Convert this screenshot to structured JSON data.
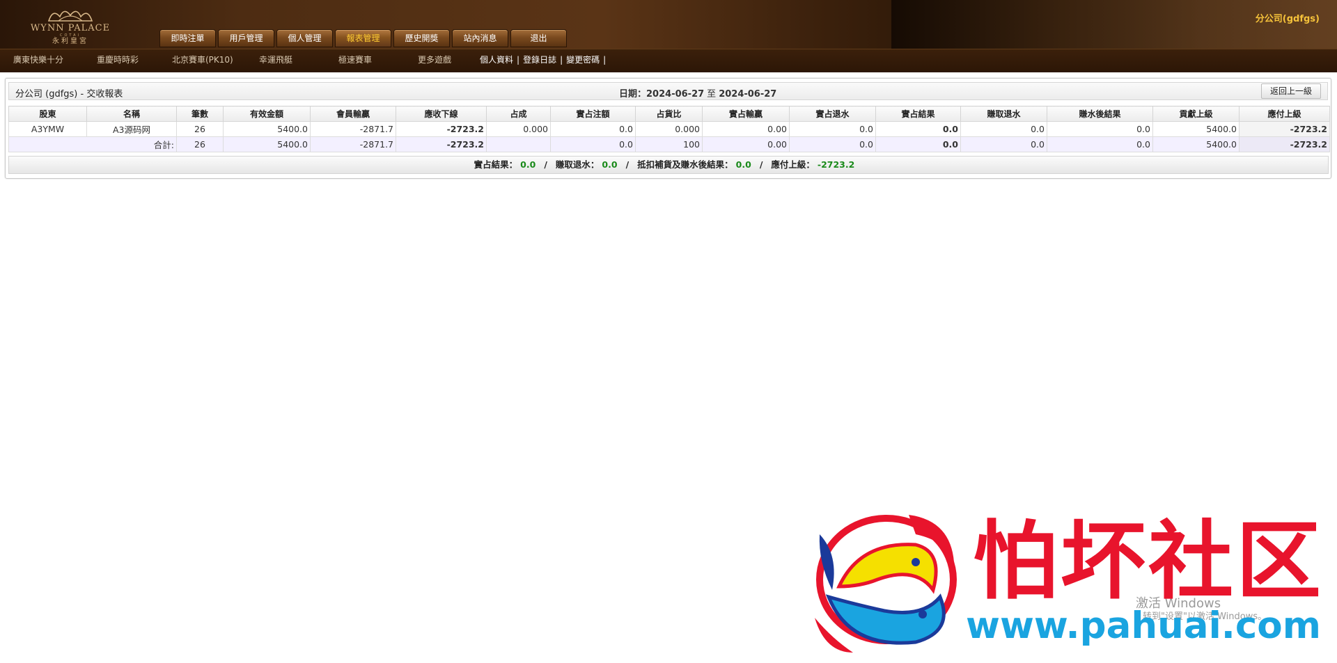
{
  "header": {
    "logo": {
      "en": "WYNN PALACE",
      "cotai": "COTAI",
      "cn": "永利皇宮"
    },
    "main_nav": [
      {
        "label": "即時注單",
        "active": false
      },
      {
        "label": "用戶管理",
        "active": false
      },
      {
        "label": "個人管理",
        "active": false
      },
      {
        "label": "報表管理",
        "active": true
      },
      {
        "label": "歷史開獎",
        "active": false
      },
      {
        "label": "站內消息",
        "active": false
      },
      {
        "label": "退出",
        "active": false
      }
    ],
    "company": "分公司(gdfgs)",
    "sub_nav": {
      "games": [
        "廣東快樂十分",
        "重慶時時彩",
        "北京賽車(PK10)",
        "幸運飛艇",
        "極速賽車",
        "更多遊戲"
      ],
      "user_links": [
        "個人資料",
        "登錄日誌",
        "變更密碼"
      ]
    }
  },
  "report": {
    "title": "分公司 (gdfgs) - 交收報表",
    "date_label": "日期：",
    "date_from": "2024-06-27",
    "date_sep": "至",
    "date_to": "2024-06-27",
    "back_label": "返回上一級",
    "columns": [
      "股東",
      "名稱",
      "筆數",
      "有效金額",
      "會員輸贏",
      "應收下線",
      "占成",
      "實占注額",
      "占貨比",
      "實占輸贏",
      "實占退水",
      "實占結果",
      "賺取退水",
      "賺水後結果",
      "貢獻上級",
      "應付上級"
    ],
    "rows": [
      {
        "shareholder": "A3YMW",
        "name": "A3源码网",
        "count": "26",
        "valid_amount": "5400.0",
        "member_win": "-2871.7",
        "receivable": "-2723.2",
        "share_pct": "0.000",
        "real_bet": "0.0",
        "ratio": "0.000",
        "real_win": "0.00",
        "real_rebate": "0.0",
        "real_result": "0.0",
        "earned_rebate": "0.0",
        "after_rebate": "0.0",
        "contribute": "5400.0",
        "payable": "-2723.2"
      }
    ],
    "total": {
      "label": "合計:",
      "count": "26",
      "valid_amount": "5400.0",
      "member_win": "-2871.7",
      "receivable": "-2723.2",
      "share_pct": "",
      "real_bet": "0.0",
      "ratio": "100",
      "real_win": "0.00",
      "real_rebate": "0.0",
      "real_result": "0.0",
      "earned_rebate": "0.0",
      "after_rebate": "0.0",
      "contribute": "5400.0",
      "payable": "-2723.2"
    },
    "summary": [
      {
        "label": "實占結果：",
        "value": "0.0"
      },
      {
        "label": "賺取退水：",
        "value": "0.0"
      },
      {
        "label": "抵扣補貨及賺水後結果：",
        "value": "0.0"
      },
      {
        "label": "應付上級：",
        "value": "-2723.2"
      }
    ]
  },
  "overlay": {
    "activate_line1": "激活 Windows",
    "activate_line2": "转到\"设置\"以激活 Windows。",
    "watermark_cn": "怕坏社区",
    "watermark_url": "www.pahuai.com"
  },
  "colors": {
    "accent_gold": "#f5c23a",
    "negative": "#b0192a",
    "positive": "#1a8a1a"
  }
}
